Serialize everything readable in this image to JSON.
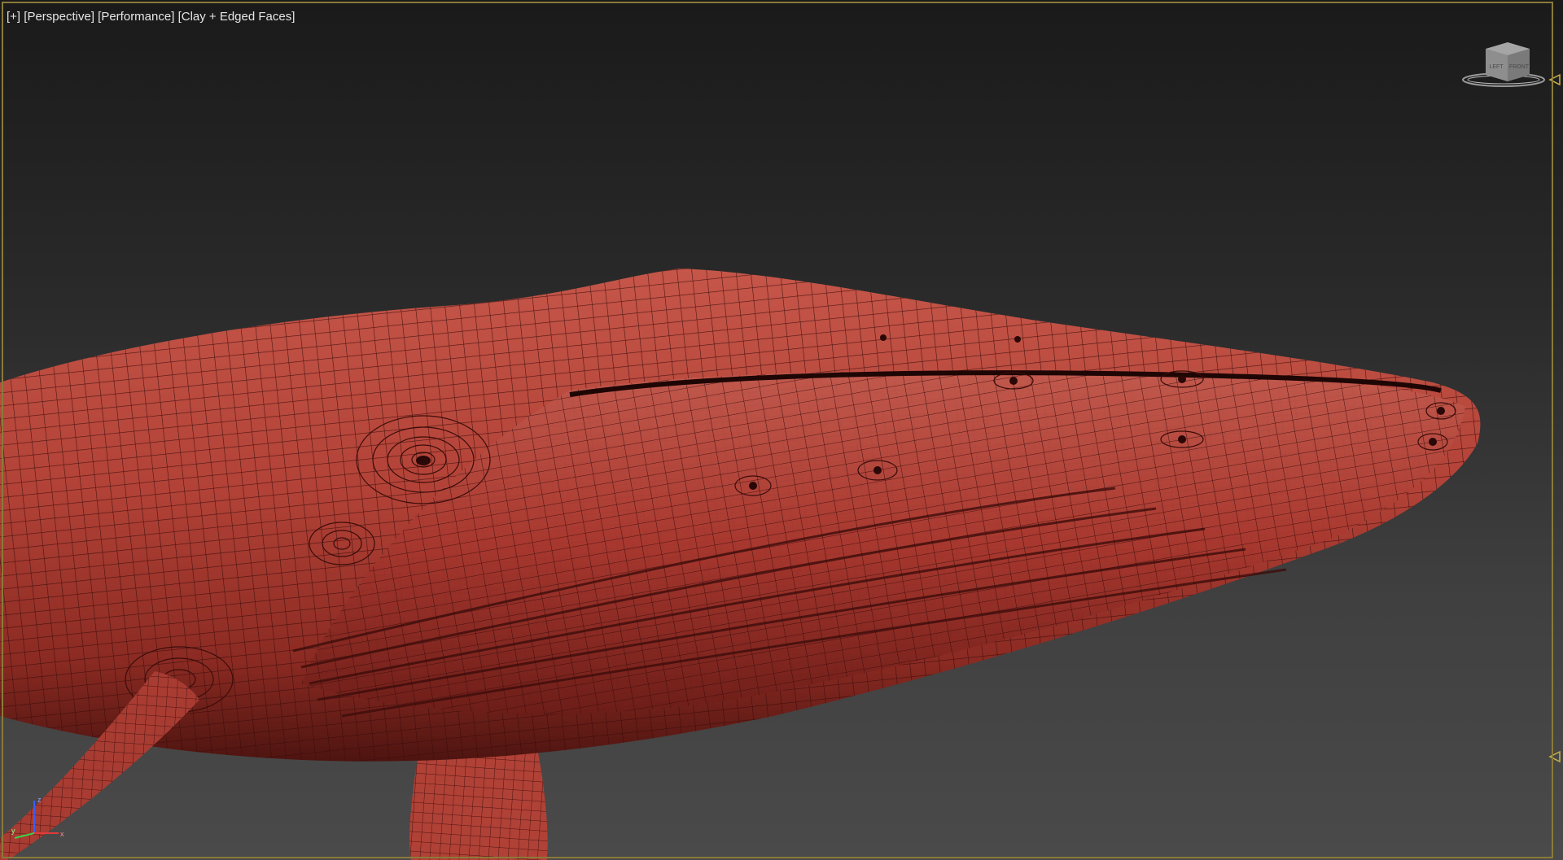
{
  "viewport": {
    "label_plus": "[+]",
    "label_view": "[Perspective]",
    "label_perf": "[Performance]",
    "label_shading": "[Clay + Edged Faces]"
  },
  "viewcube": {
    "icon": "viewcube-icon",
    "face_left": "LEFT",
    "face_front": "FRONT"
  },
  "axis": {
    "x": "x",
    "y": "y",
    "z": "z"
  },
  "colors": {
    "frame": "#8a7a3a",
    "mesh": "#b4453a",
    "wire": "#3a0c0a",
    "background_top": "#1a1a1a",
    "background_bottom": "#4a4a4a"
  }
}
